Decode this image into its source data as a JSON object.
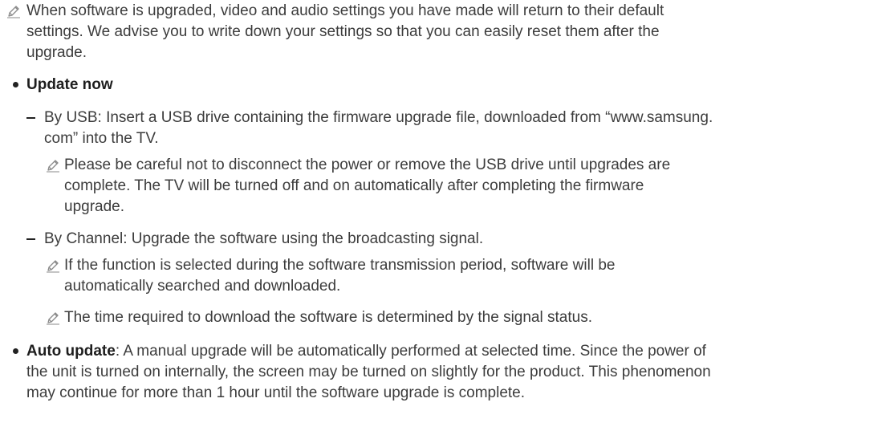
{
  "note_intro": {
    "lines": [
      "When software is upgraded, video and audio settings you have made will return to their default",
      "settings. We advise you to write down your settings so that you can easily reset them after the",
      "upgrade."
    ]
  },
  "update_now": {
    "title": "Update now",
    "by_usb": {
      "lines": [
        "By USB: Insert a USB drive containing the firmware upgrade file, downloaded from “www.samsung.",
        "com” into the TV."
      ],
      "note_lines": [
        "Please be careful not to disconnect the power or remove the USB drive until upgrades are",
        "complete. The TV will be turned off and on automatically after completing the firmware",
        "upgrade."
      ]
    },
    "by_channel": {
      "text": "By Channel: Upgrade the software using the broadcasting signal.",
      "note1_lines": [
        "If the function is selected during the software transmission period, software will be",
        "automatically searched and downloaded."
      ],
      "note2_text": "The time required to download the software is determined by the signal status."
    }
  },
  "auto_update": {
    "title": "Auto update",
    "lines": [
      ": A manual upgrade will be automatically performed at selected time. Since the power of",
      "the unit is turned on internally, the screen may be turned on slightly for the product. This phenomenon",
      "may continue for more than 1 hour until the software upgrade is complete."
    ]
  },
  "icons": {
    "note": "pencil-note-icon",
    "bullet": "bullet-dot",
    "dash": "dash-marker"
  },
  "colors": {
    "text": "#3c3c3c",
    "heading": "#1e1e1e",
    "icon": "#8a8a8a"
  }
}
